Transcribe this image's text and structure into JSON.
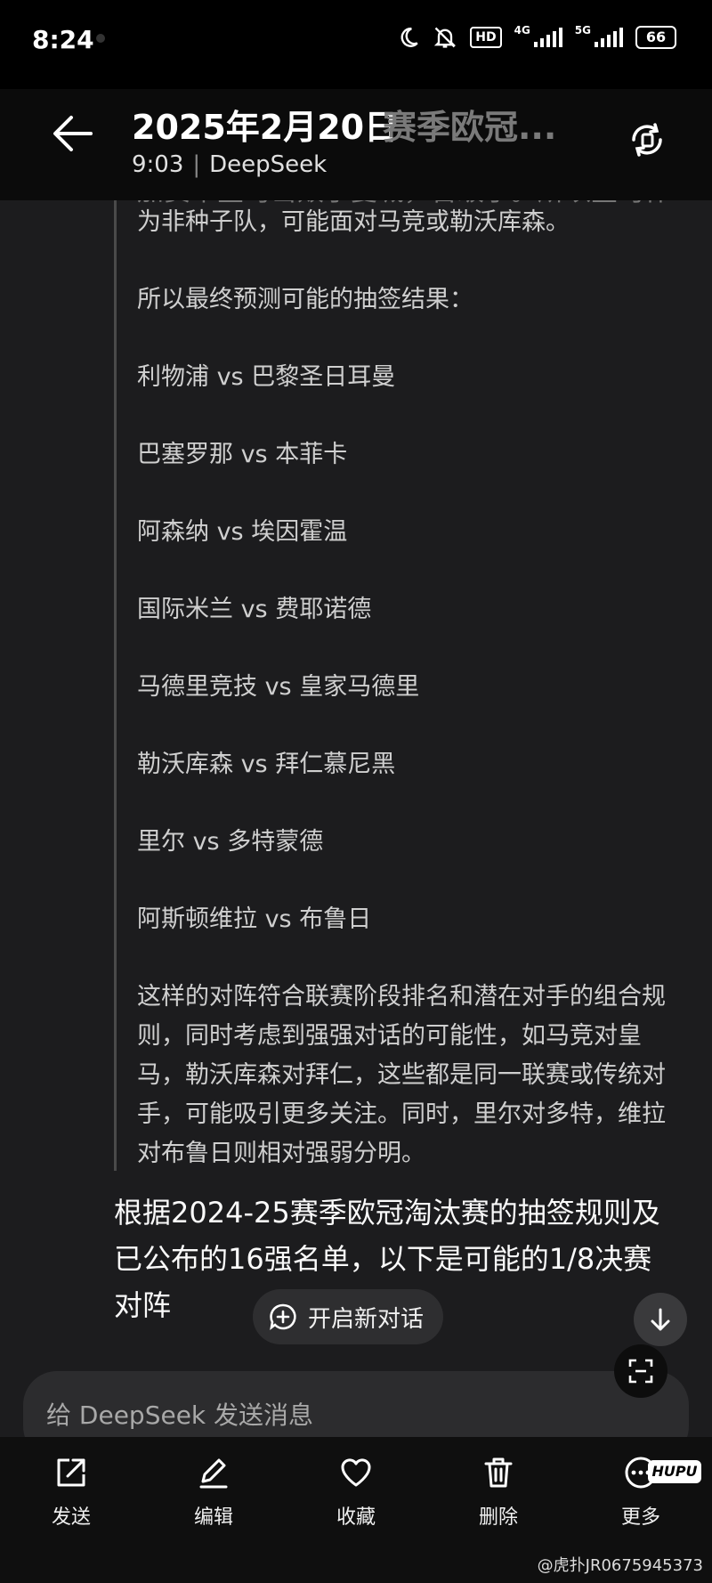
{
  "status": {
    "time": "8:24",
    "hd_label": "HD",
    "network_1": "4G",
    "network_2": "5G",
    "battery": "66"
  },
  "header": {
    "title": "2025年2月20日",
    "title_faded": "赛季欧冠...",
    "time": "9:03",
    "source": "DeepSeek"
  },
  "thinking": {
    "partial_line": "加赛中皇马击败了曼城，晋级了。所以皇马作",
    "intro": "为非种子队，可能面对马竞或勒沃库森。",
    "lead": "所以最终预测可能的抽签结果：",
    "matchups": [
      "利物浦 vs 巴黎圣日耳曼",
      "巴塞罗那 vs 本菲卡",
      "阿森纳 vs 埃因霍温",
      "国际米兰 vs 费耶诺德",
      "马德里竞技 vs 皇家马德里",
      "勒沃库森 vs 拜仁慕尼黑",
      "里尔 vs 多特蒙德",
      "阿斯顿维拉 vs 布鲁日"
    ],
    "conclusion": "这样的对阵符合联赛阶段排名和潜在对手的组合规则，同时考虑到强强对话的可能性，如马竞对皇马，勒沃库森对拜仁，这些都是同一联赛或传统对手，可能吸引更多关注。同时，里尔对多特，维拉对布鲁日则相对强弱分明。"
  },
  "answer": {
    "text": "根据2024-25赛季欧冠淘汰赛的抽签规则及已公布的16强名单，以下是可能的1/8决赛对阵"
  },
  "new_chat": {
    "label": "开启新对话"
  },
  "input": {
    "placeholder": "给 DeepSeek 发送消息"
  },
  "actions": {
    "send": "发送",
    "edit": "编辑",
    "favorite": "收藏",
    "delete": "删除",
    "more": "更多"
  },
  "watermark": {
    "badge": "HUPU",
    "text": "@虎扑JR0675945373"
  }
}
